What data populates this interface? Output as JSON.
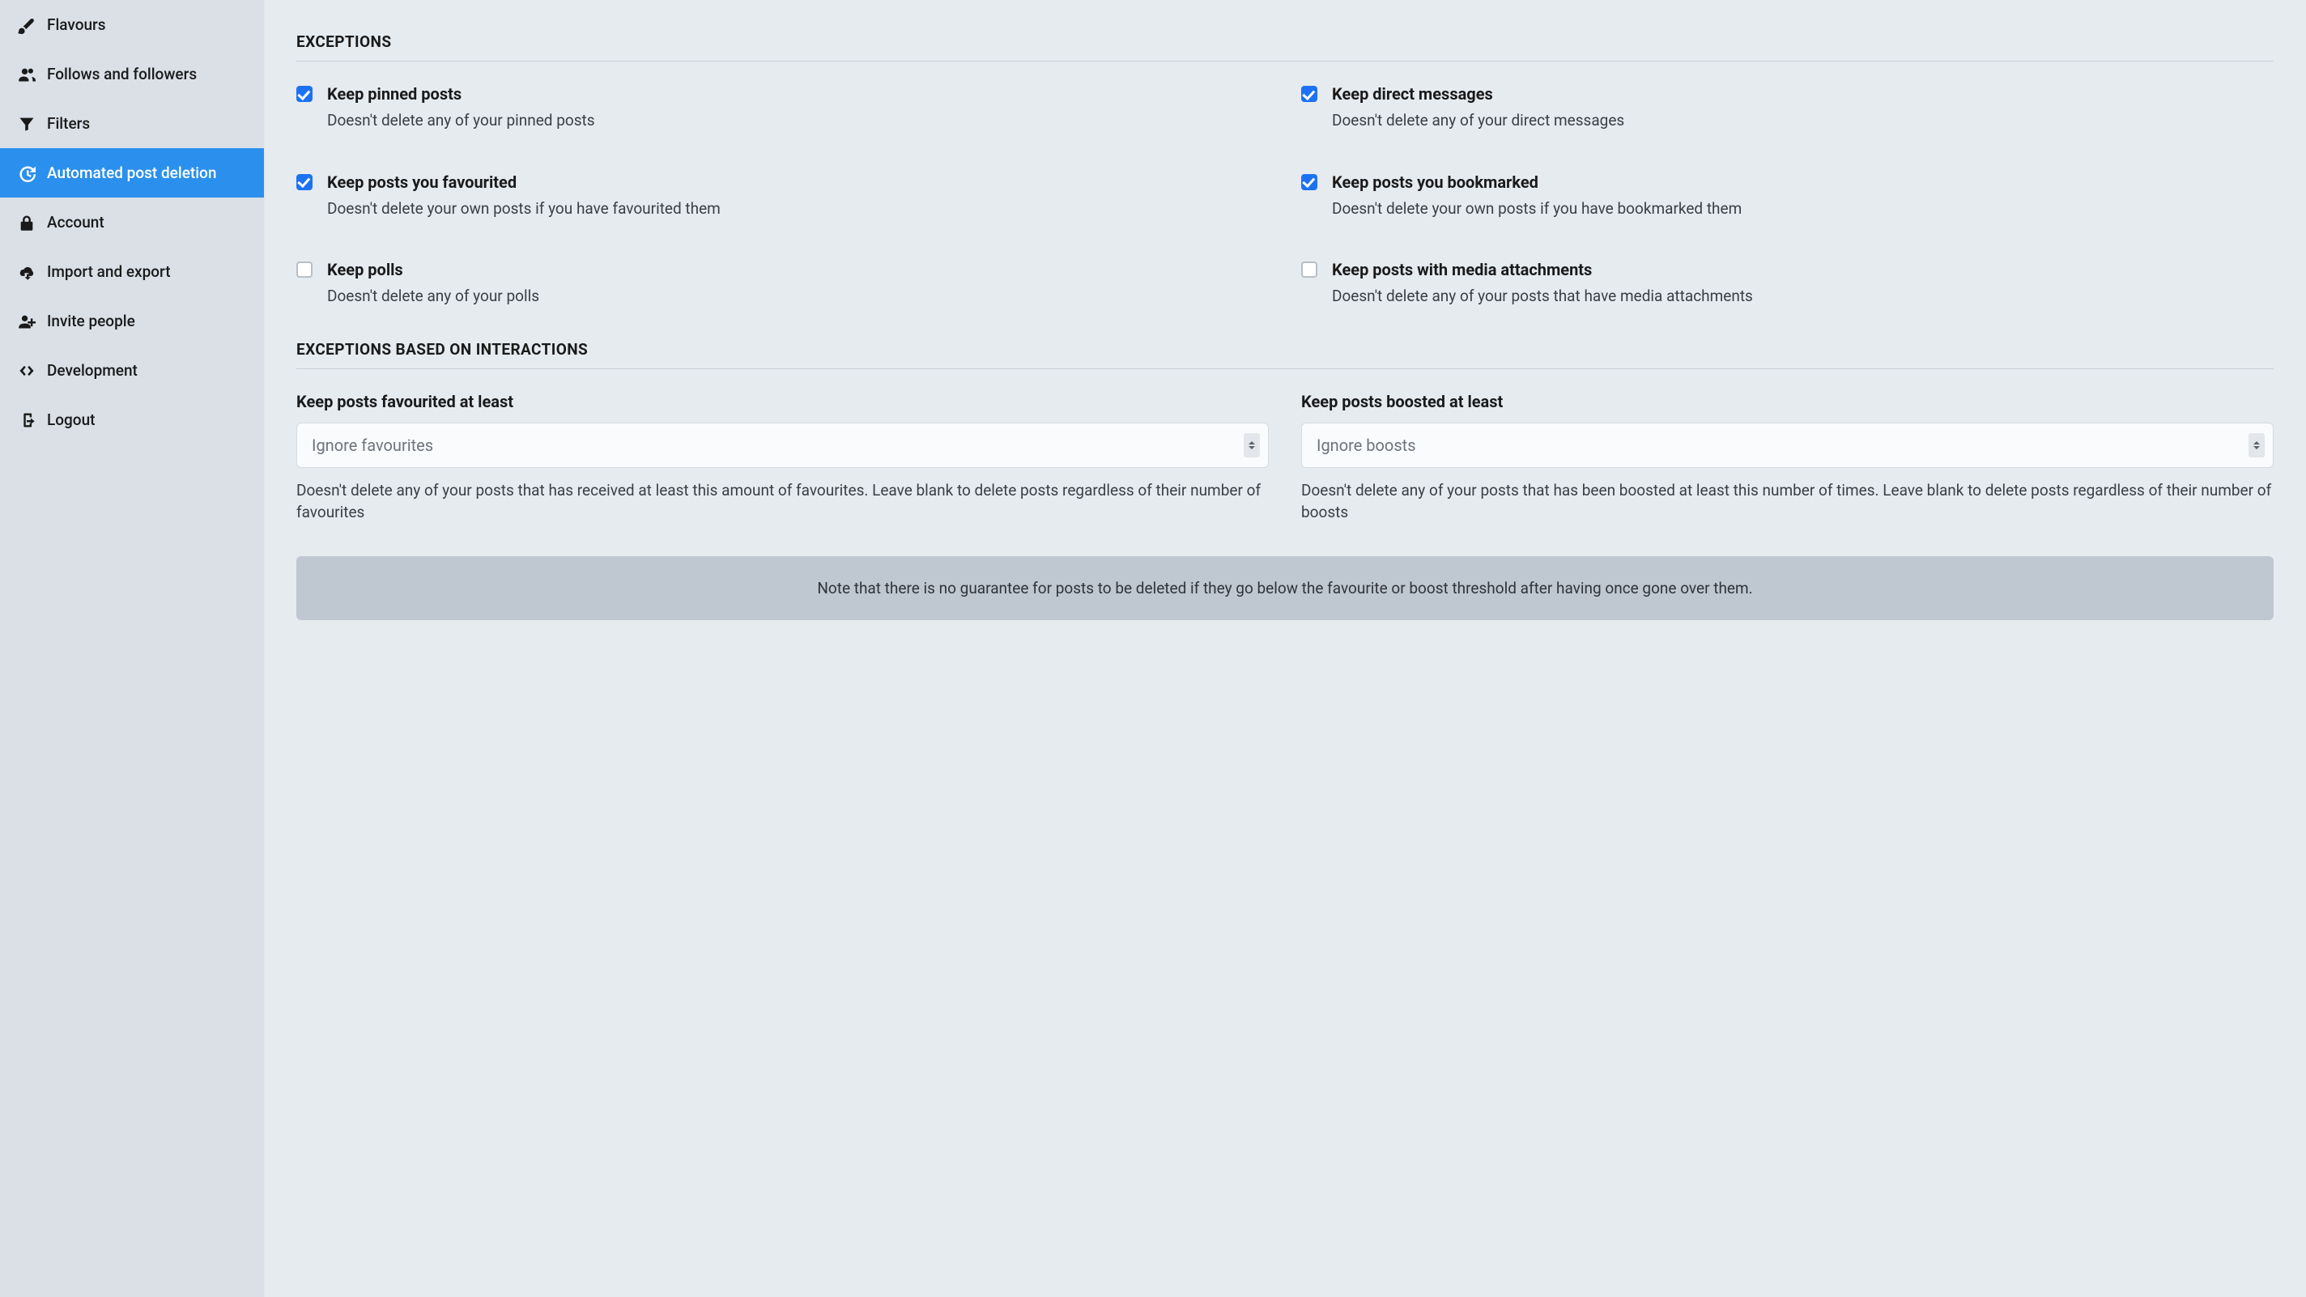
{
  "sidebar": {
    "items": [
      {
        "id": "flavours",
        "label": "Flavours",
        "icon": "paintbrush-icon",
        "active": false
      },
      {
        "id": "follows",
        "label": "Follows and followers",
        "icon": "users-icon",
        "active": false
      },
      {
        "id": "filters",
        "label": "Filters",
        "icon": "filter-icon",
        "active": false
      },
      {
        "id": "autodelete",
        "label": "Automated post deletion",
        "icon": "history-icon",
        "active": true
      },
      {
        "id": "account",
        "label": "Account",
        "icon": "lock-icon",
        "active": false
      },
      {
        "id": "importexport",
        "label": "Import and export",
        "icon": "cloud-download-icon",
        "active": false
      },
      {
        "id": "invite",
        "label": "Invite people",
        "icon": "user-plus-icon",
        "active": false
      },
      {
        "id": "development",
        "label": "Development",
        "icon": "code-icon",
        "active": false
      },
      {
        "id": "logout",
        "label": "Logout",
        "icon": "sign-out-icon",
        "active": false
      }
    ]
  },
  "sections": {
    "exceptions": {
      "title": "EXCEPTIONS",
      "options": [
        {
          "id": "keep-pinned",
          "label": "Keep pinned posts",
          "help": "Doesn't delete any of your pinned posts",
          "checked": true
        },
        {
          "id": "keep-dms",
          "label": "Keep direct messages",
          "help": "Doesn't delete any of your direct messages",
          "checked": true
        },
        {
          "id": "keep-fav",
          "label": "Keep posts you favourited",
          "help": "Doesn't delete your own posts if you have favourited them",
          "checked": true
        },
        {
          "id": "keep-bookmarked",
          "label": "Keep posts you bookmarked",
          "help": "Doesn't delete your own posts if you have bookmarked them",
          "checked": true
        },
        {
          "id": "keep-polls",
          "label": "Keep polls",
          "help": "Doesn't delete any of your polls",
          "checked": false
        },
        {
          "id": "keep-media",
          "label": "Keep posts with media attachments",
          "help": "Doesn't delete any of your posts that have media attachments",
          "checked": false
        }
      ]
    },
    "interactions": {
      "title": "EXCEPTIONS BASED ON INTERACTIONS",
      "selects": [
        {
          "id": "min-favs",
          "label": "Keep posts favourited at least",
          "value": "Ignore favourites",
          "help": "Doesn't delete any of your posts that has received at least this amount of favourites. Leave blank to delete posts regardless of their number of favourites"
        },
        {
          "id": "min-boosts",
          "label": "Keep posts boosted at least",
          "value": "Ignore boosts",
          "help": "Doesn't delete any of your posts that has been boosted at least this number of times. Leave blank to delete posts regardless of their number of boosts"
        }
      ],
      "note": "Note that there is no guarantee for posts to be deleted if they go below the favourite or boost threshold after having once gone over them."
    }
  }
}
